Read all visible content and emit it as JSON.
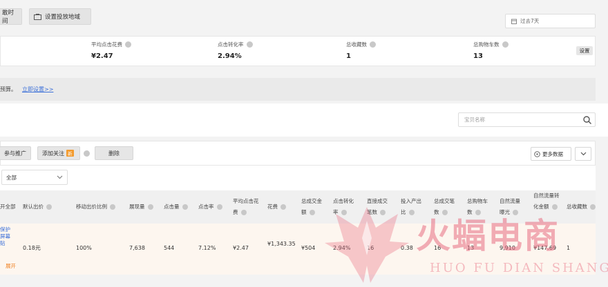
{
  "topbar": {
    "btn_time": "敢时间",
    "btn_region": "设置投放地域",
    "date_range": "过去7天"
  },
  "stats": [
    {
      "label": "平均点击花费",
      "value": "¥2.47"
    },
    {
      "label": "点击转化率",
      "value": "2.94%"
    },
    {
      "label": "总收藏数",
      "value": "1"
    },
    {
      "label": "总购物车数",
      "value": "13"
    }
  ],
  "stats_setting": "设置",
  "notice": {
    "text": "预算。",
    "link": "立即设置>>"
  },
  "search": {
    "placeholder": "宝贝名称"
  },
  "toolbar": {
    "join": "参与推广",
    "add_follow": "添加关注",
    "add_follow_badge": "新",
    "delete": "删除",
    "more_data": "更多数据"
  },
  "filter": {
    "selected": "全部"
  },
  "table": {
    "headers": [
      "开全部",
      "默认出价",
      "移动出价比例",
      "展现量",
      "点击量",
      "点击率",
      "平均点击花费",
      "花费",
      "总成交金额",
      "点击转化率",
      "直接成交笔数",
      "投入产出比",
      "总成交笔数",
      "总购物车数",
      "自然流量曝光",
      "自然流量转化金额",
      "总收藏数"
    ],
    "row": {
      "link": "保护 屏幕贴",
      "expand": "展开",
      "cells": [
        "0.18元",
        "100%",
        "7,638",
        "544",
        "7.12%",
        "¥2.47",
        "¥1,343.35",
        "¥504",
        "2.94%",
        "16",
        "0.38",
        "16",
        "13",
        "9,910",
        "¥147.69",
        "1"
      ]
    }
  },
  "watermark": {
    "cn": "火蝠电商",
    "en": "HUO FU DIAN SHANG"
  },
  "colors": {
    "link": "#3a6fd8",
    "badge": "#f39b2e",
    "expand": "#f08020",
    "row_bg": "#fdf6ef",
    "watermark": "#e86e82"
  }
}
